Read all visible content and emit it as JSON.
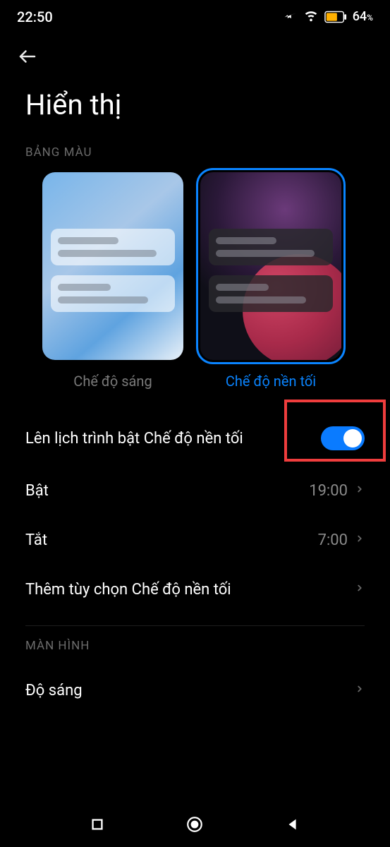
{
  "status": {
    "time": "22:50",
    "battery_text": "64",
    "battery_pct_suffix": "%"
  },
  "page": {
    "title": "Hiển thị"
  },
  "sections": {
    "color": "BẢNG MÀU",
    "screen": "MÀN HÌNH"
  },
  "themes": {
    "light": "Chế độ sáng",
    "dark": "Chế độ nền tối"
  },
  "items": {
    "schedule_label": "Lên lịch trình bật Chế độ nền tối",
    "on_label": "Bật",
    "on_value": "19:00",
    "off_label": "Tắt",
    "off_value": "7:00",
    "more_label": "Thêm tùy chọn Chế độ nền tối",
    "brightness_label": "Độ sáng"
  }
}
